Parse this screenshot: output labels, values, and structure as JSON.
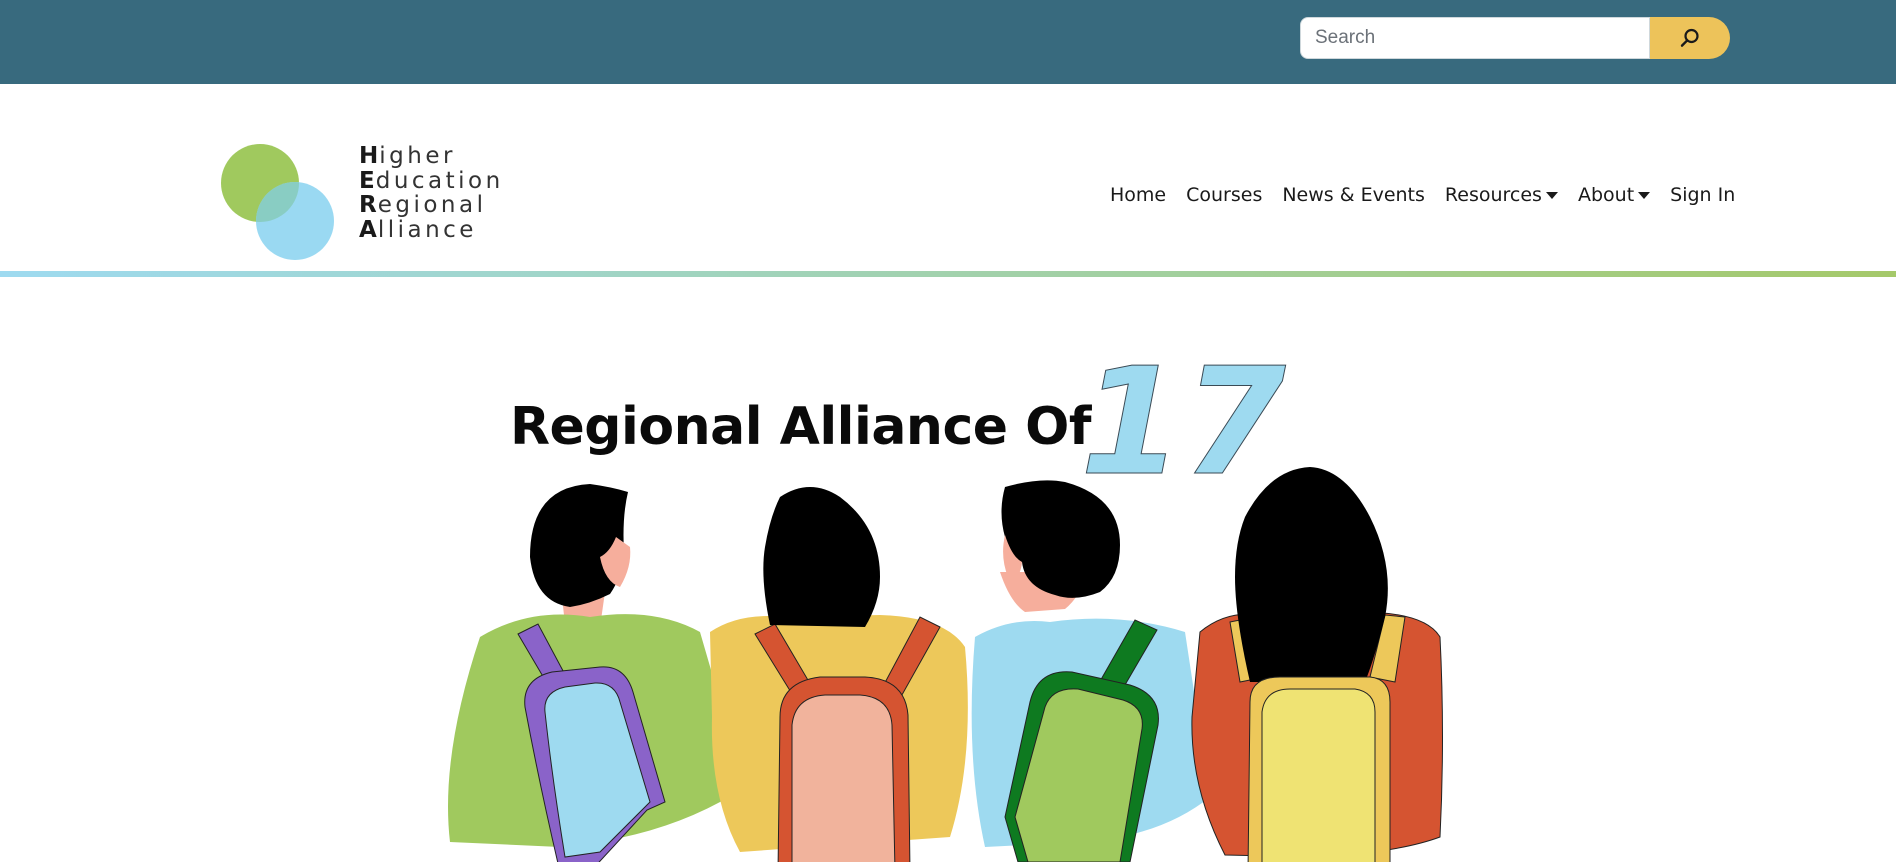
{
  "search": {
    "placeholder": "Search",
    "button_icon": "search-icon"
  },
  "logo": {
    "lines": [
      {
        "initial": "H",
        "rest": "igher"
      },
      {
        "initial": "E",
        "rest": "ducation"
      },
      {
        "initial": "R",
        "rest": "egional"
      },
      {
        "initial": "A",
        "rest": "lliance"
      }
    ],
    "colors": {
      "green": "#a0c95e",
      "blue": "#9ad9f2"
    }
  },
  "nav": {
    "items": [
      {
        "label": "Home",
        "dropdown": false
      },
      {
        "label": "Courses",
        "dropdown": false
      },
      {
        "label": "News & Events",
        "dropdown": false
      },
      {
        "label": "Resources",
        "dropdown": true
      },
      {
        "label": "About",
        "dropdown": true
      },
      {
        "label": "Sign In",
        "dropdown": false
      }
    ]
  },
  "hero": {
    "title": "Regional Alliance Of",
    "number": "17"
  },
  "colors": {
    "topbar": "#386a7e",
    "search_button": "#edc35a",
    "accent_blue": "#9edaf0",
    "accent_green": "#a5c96a"
  }
}
